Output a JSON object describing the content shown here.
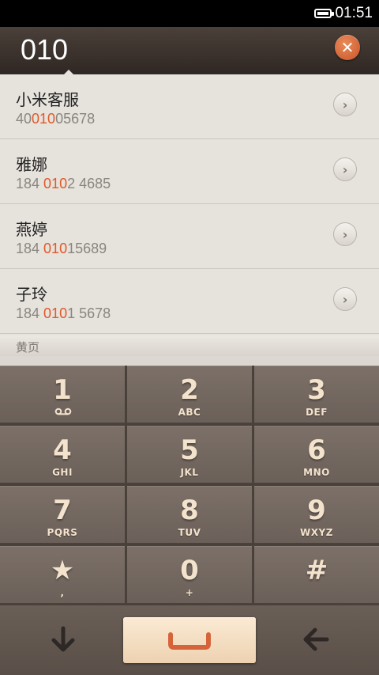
{
  "status_bar": {
    "time": "01:51",
    "battery_icon": "battery-icon"
  },
  "search": {
    "query": "010",
    "clear_icon": "close-icon"
  },
  "results": [
    {
      "name": "小米客服",
      "number_prefix": "40",
      "number_match": "010",
      "number_suffix": "05678"
    },
    {
      "name": "雅娜",
      "number_prefix": "184 ",
      "number_match": "010",
      "number_suffix": "2 4685"
    },
    {
      "name": "燕婷",
      "number_prefix": "184 ",
      "number_match": "010",
      "number_suffix": "15689"
    },
    {
      "name": "子玲",
      "number_prefix": "184 ",
      "number_match": "010",
      "number_suffix": "1 5678"
    }
  ],
  "section": {
    "label": "黄页"
  },
  "keypad": {
    "keys": [
      {
        "digit": "1",
        "letters": ""
      },
      {
        "digit": "2",
        "letters": "ABC"
      },
      {
        "digit": "3",
        "letters": "DEF"
      },
      {
        "digit": "4",
        "letters": "GHI"
      },
      {
        "digit": "5",
        "letters": "JKL"
      },
      {
        "digit": "6",
        "letters": "MNO"
      },
      {
        "digit": "7",
        "letters": "PQRS"
      },
      {
        "digit": "8",
        "letters": "TUV"
      },
      {
        "digit": "9",
        "letters": "WXYZ"
      },
      {
        "digit": "★",
        "letters": ","
      },
      {
        "digit": "0",
        "letters": "+"
      },
      {
        "digit": "#",
        "letters": ""
      }
    ]
  },
  "bottom_bar": {
    "collapse_icon": "arrow-down-icon",
    "call_icon": "call-icon",
    "backspace_icon": "arrow-left-icon"
  },
  "colors": {
    "highlight": "#e0592a",
    "accent_button": "#d6643a"
  }
}
